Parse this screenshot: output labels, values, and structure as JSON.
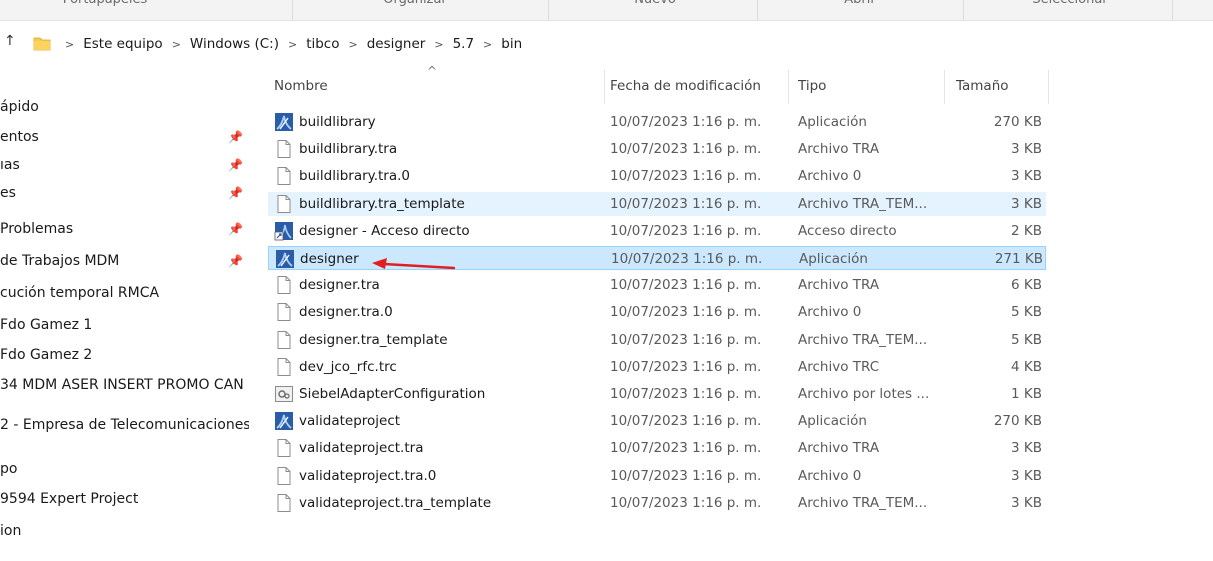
{
  "ribbon": {
    "groups": [
      "Portapapeles",
      "Organizar",
      "Nuevo",
      "Abrir",
      "Seleccionar"
    ]
  },
  "address_bar": {
    "crumbs": [
      "Este equipo",
      "Windows (C:)",
      "tibco",
      "designer",
      "5.7",
      "bin"
    ]
  },
  "nav_pane": {
    "items": [
      {
        "label": "ápido",
        "pinned": false
      },
      {
        "label": "entos",
        "pinned": true
      },
      {
        "label": "ıas",
        "pinned": true
      },
      {
        "label": "es",
        "pinned": true
      },
      {
        "label": "Problemas",
        "pinned": true
      },
      {
        "label": "de Trabajos MDM",
        "pinned": true
      },
      {
        "label": "cución temporal RMCA",
        "pinned": false
      },
      {
        "label": "Fdo Gamez 1",
        "pinned": false
      },
      {
        "label": "Fdo Gamez 2",
        "pinned": false
      },
      {
        "label": "34 MDM ASER INSERT PROMO CAN",
        "pinned": false
      },
      {
        "label": "2 - Empresa de Telecomunicaciones",
        "pinned": false
      },
      {
        "label": "po",
        "pinned": false
      },
      {
        "label": "9594 Expert Project",
        "pinned": false
      },
      {
        "label": "ion",
        "pinned": false
      }
    ]
  },
  "columns": {
    "name": "Nombre",
    "date": "Fecha de modificación",
    "type": "Tipo",
    "size": "Tamaño"
  },
  "files": [
    {
      "name": "buildlibrary",
      "date": "10/07/2023 1:16 p. m.",
      "type": "Aplicación",
      "size": "270 KB",
      "icon": "app-icon",
      "state": ""
    },
    {
      "name": "buildlibrary.tra",
      "date": "10/07/2023 1:16 p. m.",
      "type": "Archivo TRA",
      "size": "3 KB",
      "icon": "file-icon",
      "state": ""
    },
    {
      "name": "buildlibrary.tra.0",
      "date": "10/07/2023 1:16 p. m.",
      "type": "Archivo 0",
      "size": "3 KB",
      "icon": "file-icon",
      "state": ""
    },
    {
      "name": "buildlibrary.tra_template",
      "date": "10/07/2023 1:16 p. m.",
      "type": "Archivo TRA_TEM...",
      "size": "3 KB",
      "icon": "file-icon",
      "state": "hover"
    },
    {
      "name": "designer - Acceso directo",
      "date": "10/07/2023 1:16 p. m.",
      "type": "Acceso directo",
      "size": "2 KB",
      "icon": "shortcut-icon",
      "state": ""
    },
    {
      "name": "designer",
      "date": "10/07/2023 1:16 p. m.",
      "type": "Aplicación",
      "size": "271 KB",
      "icon": "app-icon",
      "state": "selected"
    },
    {
      "name": "designer.tra",
      "date": "10/07/2023 1:16 p. m.",
      "type": "Archivo TRA",
      "size": "6 KB",
      "icon": "file-icon",
      "state": ""
    },
    {
      "name": "designer.tra.0",
      "date": "10/07/2023 1:16 p. m.",
      "type": "Archivo 0",
      "size": "5 KB",
      "icon": "file-icon",
      "state": ""
    },
    {
      "name": "designer.tra_template",
      "date": "10/07/2023 1:16 p. m.",
      "type": "Archivo TRA_TEM...",
      "size": "5 KB",
      "icon": "file-icon",
      "state": ""
    },
    {
      "name": "dev_jco_rfc.trc",
      "date": "10/07/2023 1:16 p. m.",
      "type": "Archivo TRC",
      "size": "4 KB",
      "icon": "file-icon",
      "state": ""
    },
    {
      "name": "SiebelAdapterConfiguration",
      "date": "10/07/2023 1:16 p. m.",
      "type": "Archivo por lotes ...",
      "size": "1 KB",
      "icon": "batch-icon",
      "state": ""
    },
    {
      "name": "validateproject",
      "date": "10/07/2023 1:16 p. m.",
      "type": "Aplicación",
      "size": "270 KB",
      "icon": "app-icon",
      "state": ""
    },
    {
      "name": "validateproject.tra",
      "date": "10/07/2023 1:16 p. m.",
      "type": "Archivo TRA",
      "size": "3 KB",
      "icon": "file-icon",
      "state": ""
    },
    {
      "name": "validateproject.tra.0",
      "date": "10/07/2023 1:16 p. m.",
      "type": "Archivo 0",
      "size": "3 KB",
      "icon": "file-icon",
      "state": ""
    },
    {
      "name": "validateproject.tra_template",
      "date": "10/07/2023 1:16 p. m.",
      "type": "Archivo TRA_TEM...",
      "size": "3 KB",
      "icon": "file-icon",
      "state": ""
    }
  ],
  "colors": {
    "hover": "#e5f3ff",
    "selected": "#cce8ff",
    "selected_border": "#99d1ff",
    "annotation_arrow": "#e02020",
    "folder": "#f8c948"
  }
}
